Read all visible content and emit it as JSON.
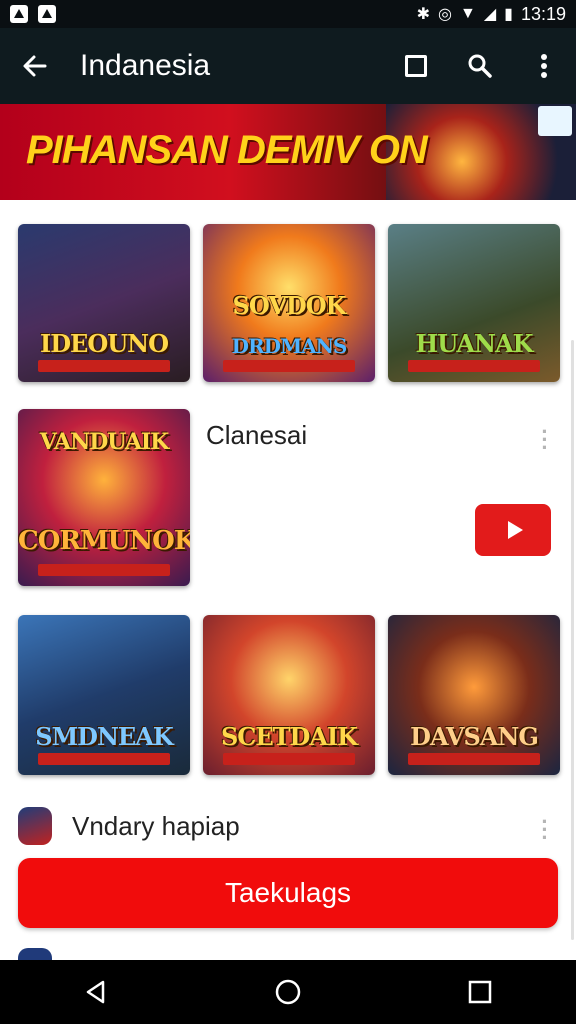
{
  "status_bar": {
    "time": "13:19"
  },
  "app_bar": {
    "title": "Indanesia"
  },
  "banner": {
    "text": "PIHANSAN DEMIV ON"
  },
  "grid_row1": [
    {
      "label": "IDEOUNO"
    },
    {
      "label": "SOVDOK",
      "sub": "DRDMANS"
    },
    {
      "label": "HUANAK"
    }
  ],
  "featured": {
    "title": "Clanesai",
    "tile_label": "CORMUNOK",
    "tile_top_label": "VANDUAIK"
  },
  "grid_row2": [
    {
      "label": "SMDNEAK"
    },
    {
      "label": "SCETDAIK"
    },
    {
      "label": "DAVSANG"
    }
  ],
  "channel": {
    "name": "Vndary hapiap"
  },
  "cta": {
    "label": "Taekulags"
  },
  "colors": {
    "accent_red": "#f10c0c",
    "appbar": "#0f1b1f",
    "youtube_red": "#e21b1b"
  }
}
